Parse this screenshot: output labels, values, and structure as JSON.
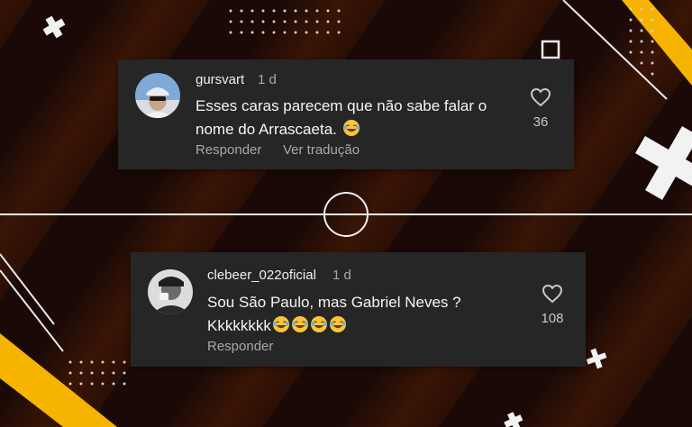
{
  "comments": [
    {
      "username": "gursvart",
      "time": "1 d",
      "text_line1": "Esses caras parecem que não sabe falar o",
      "text_line2": "nome do Arrascaeta.",
      "emoji_count": 1,
      "likes": "36",
      "reply_label": "Responder",
      "translate_label": "Ver tradução"
    },
    {
      "username": "clebeer_022oficial",
      "time": "1 d",
      "text_line1": "Sou São Paulo, mas Gabriel Neves ?",
      "text_line2": "Kkkkkkkk",
      "emoji_count": 4,
      "likes": "108",
      "reply_label": "Responder"
    }
  ],
  "colors": {
    "card": "#262626",
    "accent_yellow": "#f6b400",
    "secondary_text": "#a8a8a8"
  },
  "icons": [
    "heart-icon",
    "laughing-emoji-icon",
    "plus-icon",
    "square-icon",
    "circle-icon"
  ]
}
